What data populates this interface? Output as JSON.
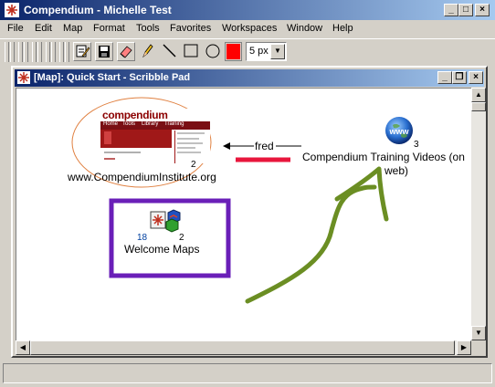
{
  "app": {
    "title": "Compendium - Michelle Test",
    "window_buttons": {
      "minimize": "_",
      "maximize": "□",
      "close": "×"
    }
  },
  "menu": [
    "File",
    "Edit",
    "Map",
    "Format",
    "Tools",
    "Favorites",
    "Workspaces",
    "Window",
    "Help"
  ],
  "toolbar": {
    "line_color": "#ff0000",
    "line_width_value": "5 px"
  },
  "map_window": {
    "title": "[Map]: Quick Start - Scribble Pad"
  },
  "map": {
    "nodes": {
      "website": {
        "label": "www.CompendiumInstitute.org",
        "count": "2",
        "thumb_logo": "compendium",
        "thumb_nav": [
          "Home",
          "Tools",
          "Library",
          "Training"
        ]
      },
      "videos": {
        "label_line1": "Compendium Training Videos (on",
        "label_line2": "web)",
        "count": "3",
        "icon": "globe-icon",
        "icon_text": "www"
      },
      "welcome": {
        "label": "Welcome Maps",
        "count_left": "18",
        "count_right": "2",
        "icon": "map-node-icon"
      }
    },
    "link_label": "fred"
  }
}
